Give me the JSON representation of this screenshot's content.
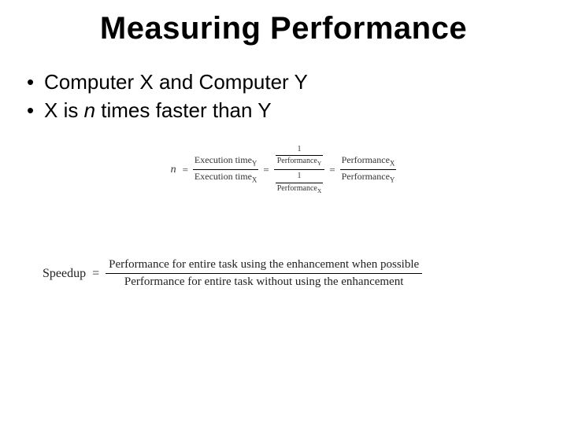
{
  "title": "Measuring Performance",
  "bullets": [
    {
      "plain": "Computer X and Computer Y"
    },
    {
      "prefix": "X is ",
      "italic": "n",
      "suffix": " times faster than Y"
    }
  ],
  "formula1": {
    "lhs": "n",
    "eq": "=",
    "first_frac": {
      "num_base": "Execution time",
      "num_sub": "Y",
      "den_base": "Execution time",
      "den_sub": "X"
    },
    "middle_frac": {
      "top": {
        "num": "1",
        "den_base": "Performance",
        "den_sub": "Y"
      },
      "bot": {
        "num": "1",
        "den_base": "Performance",
        "den_sub": "X"
      }
    },
    "last_frac": {
      "num_base": "Performance",
      "num_sub": "X",
      "den_base": "Performance",
      "den_sub": "Y"
    }
  },
  "formula2": {
    "lhs": "Speedup",
    "eq": "=",
    "num": "Performance for entire task using the enhancement when possible",
    "den": "Performance for entire task without using the enhancement"
  }
}
